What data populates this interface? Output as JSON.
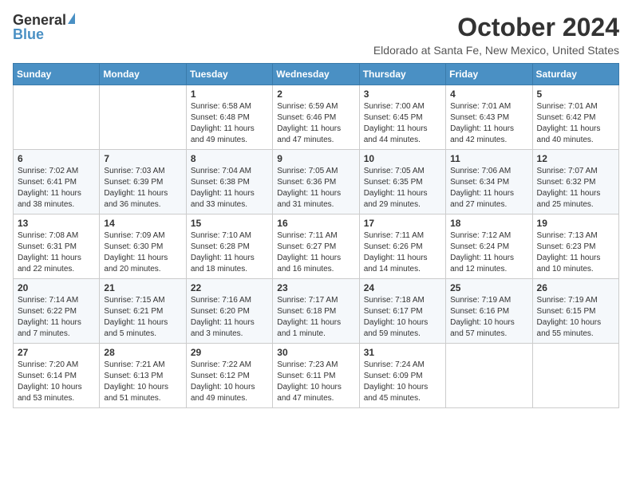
{
  "header": {
    "logo_general": "General",
    "logo_blue": "Blue",
    "month_title": "October 2024",
    "location": "Eldorado at Santa Fe, New Mexico, United States"
  },
  "days_of_week": [
    "Sunday",
    "Monday",
    "Tuesday",
    "Wednesday",
    "Thursday",
    "Friday",
    "Saturday"
  ],
  "weeks": [
    [
      {
        "day": "",
        "info": ""
      },
      {
        "day": "",
        "info": ""
      },
      {
        "day": "1",
        "info": "Sunrise: 6:58 AM\nSunset: 6:48 PM\nDaylight: 11 hours and 49 minutes."
      },
      {
        "day": "2",
        "info": "Sunrise: 6:59 AM\nSunset: 6:46 PM\nDaylight: 11 hours and 47 minutes."
      },
      {
        "day": "3",
        "info": "Sunrise: 7:00 AM\nSunset: 6:45 PM\nDaylight: 11 hours and 44 minutes."
      },
      {
        "day": "4",
        "info": "Sunrise: 7:01 AM\nSunset: 6:43 PM\nDaylight: 11 hours and 42 minutes."
      },
      {
        "day": "5",
        "info": "Sunrise: 7:01 AM\nSunset: 6:42 PM\nDaylight: 11 hours and 40 minutes."
      }
    ],
    [
      {
        "day": "6",
        "info": "Sunrise: 7:02 AM\nSunset: 6:41 PM\nDaylight: 11 hours and 38 minutes."
      },
      {
        "day": "7",
        "info": "Sunrise: 7:03 AM\nSunset: 6:39 PM\nDaylight: 11 hours and 36 minutes."
      },
      {
        "day": "8",
        "info": "Sunrise: 7:04 AM\nSunset: 6:38 PM\nDaylight: 11 hours and 33 minutes."
      },
      {
        "day": "9",
        "info": "Sunrise: 7:05 AM\nSunset: 6:36 PM\nDaylight: 11 hours and 31 minutes."
      },
      {
        "day": "10",
        "info": "Sunrise: 7:05 AM\nSunset: 6:35 PM\nDaylight: 11 hours and 29 minutes."
      },
      {
        "day": "11",
        "info": "Sunrise: 7:06 AM\nSunset: 6:34 PM\nDaylight: 11 hours and 27 minutes."
      },
      {
        "day": "12",
        "info": "Sunrise: 7:07 AM\nSunset: 6:32 PM\nDaylight: 11 hours and 25 minutes."
      }
    ],
    [
      {
        "day": "13",
        "info": "Sunrise: 7:08 AM\nSunset: 6:31 PM\nDaylight: 11 hours and 22 minutes."
      },
      {
        "day": "14",
        "info": "Sunrise: 7:09 AM\nSunset: 6:30 PM\nDaylight: 11 hours and 20 minutes."
      },
      {
        "day": "15",
        "info": "Sunrise: 7:10 AM\nSunset: 6:28 PM\nDaylight: 11 hours and 18 minutes."
      },
      {
        "day": "16",
        "info": "Sunrise: 7:11 AM\nSunset: 6:27 PM\nDaylight: 11 hours and 16 minutes."
      },
      {
        "day": "17",
        "info": "Sunrise: 7:11 AM\nSunset: 6:26 PM\nDaylight: 11 hours and 14 minutes."
      },
      {
        "day": "18",
        "info": "Sunrise: 7:12 AM\nSunset: 6:24 PM\nDaylight: 11 hours and 12 minutes."
      },
      {
        "day": "19",
        "info": "Sunrise: 7:13 AM\nSunset: 6:23 PM\nDaylight: 11 hours and 10 minutes."
      }
    ],
    [
      {
        "day": "20",
        "info": "Sunrise: 7:14 AM\nSunset: 6:22 PM\nDaylight: 11 hours and 7 minutes."
      },
      {
        "day": "21",
        "info": "Sunrise: 7:15 AM\nSunset: 6:21 PM\nDaylight: 11 hours and 5 minutes."
      },
      {
        "day": "22",
        "info": "Sunrise: 7:16 AM\nSunset: 6:20 PM\nDaylight: 11 hours and 3 minutes."
      },
      {
        "day": "23",
        "info": "Sunrise: 7:17 AM\nSunset: 6:18 PM\nDaylight: 11 hours and 1 minute."
      },
      {
        "day": "24",
        "info": "Sunrise: 7:18 AM\nSunset: 6:17 PM\nDaylight: 10 hours and 59 minutes."
      },
      {
        "day": "25",
        "info": "Sunrise: 7:19 AM\nSunset: 6:16 PM\nDaylight: 10 hours and 57 minutes."
      },
      {
        "day": "26",
        "info": "Sunrise: 7:19 AM\nSunset: 6:15 PM\nDaylight: 10 hours and 55 minutes."
      }
    ],
    [
      {
        "day": "27",
        "info": "Sunrise: 7:20 AM\nSunset: 6:14 PM\nDaylight: 10 hours and 53 minutes."
      },
      {
        "day": "28",
        "info": "Sunrise: 7:21 AM\nSunset: 6:13 PM\nDaylight: 10 hours and 51 minutes."
      },
      {
        "day": "29",
        "info": "Sunrise: 7:22 AM\nSunset: 6:12 PM\nDaylight: 10 hours and 49 minutes."
      },
      {
        "day": "30",
        "info": "Sunrise: 7:23 AM\nSunset: 6:11 PM\nDaylight: 10 hours and 47 minutes."
      },
      {
        "day": "31",
        "info": "Sunrise: 7:24 AM\nSunset: 6:09 PM\nDaylight: 10 hours and 45 minutes."
      },
      {
        "day": "",
        "info": ""
      },
      {
        "day": "",
        "info": ""
      }
    ]
  ]
}
